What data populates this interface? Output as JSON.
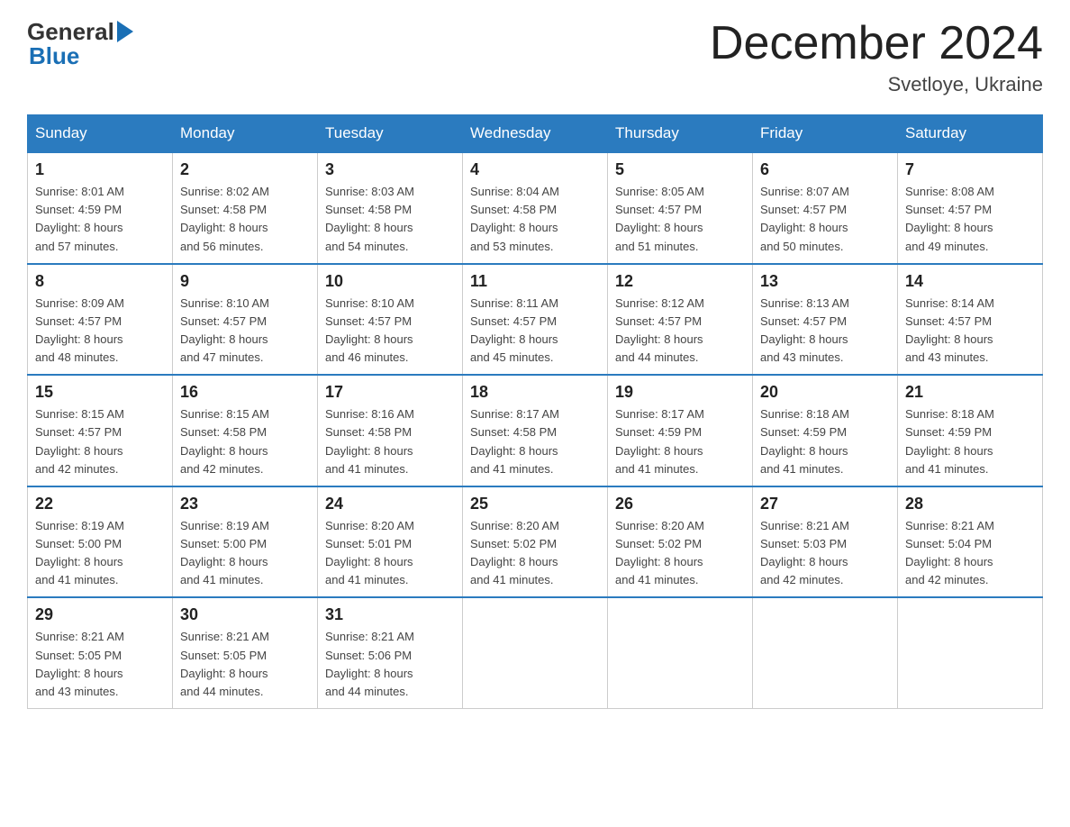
{
  "header": {
    "logo_general": "General",
    "logo_blue": "Blue",
    "month_title": "December 2024",
    "location": "Svetloye, Ukraine"
  },
  "days_of_week": [
    "Sunday",
    "Monday",
    "Tuesday",
    "Wednesday",
    "Thursday",
    "Friday",
    "Saturday"
  ],
  "weeks": [
    [
      {
        "day": "1",
        "sunrise": "8:01 AM",
        "sunset": "4:59 PM",
        "daylight": "8 hours and 57 minutes."
      },
      {
        "day": "2",
        "sunrise": "8:02 AM",
        "sunset": "4:58 PM",
        "daylight": "8 hours and 56 minutes."
      },
      {
        "day": "3",
        "sunrise": "8:03 AM",
        "sunset": "4:58 PM",
        "daylight": "8 hours and 54 minutes."
      },
      {
        "day": "4",
        "sunrise": "8:04 AM",
        "sunset": "4:58 PM",
        "daylight": "8 hours and 53 minutes."
      },
      {
        "day": "5",
        "sunrise": "8:05 AM",
        "sunset": "4:57 PM",
        "daylight": "8 hours and 51 minutes."
      },
      {
        "day": "6",
        "sunrise": "8:07 AM",
        "sunset": "4:57 PM",
        "daylight": "8 hours and 50 minutes."
      },
      {
        "day": "7",
        "sunrise": "8:08 AM",
        "sunset": "4:57 PM",
        "daylight": "8 hours and 49 minutes."
      }
    ],
    [
      {
        "day": "8",
        "sunrise": "8:09 AM",
        "sunset": "4:57 PM",
        "daylight": "8 hours and 48 minutes."
      },
      {
        "day": "9",
        "sunrise": "8:10 AM",
        "sunset": "4:57 PM",
        "daylight": "8 hours and 47 minutes."
      },
      {
        "day": "10",
        "sunrise": "8:10 AM",
        "sunset": "4:57 PM",
        "daylight": "8 hours and 46 minutes."
      },
      {
        "day": "11",
        "sunrise": "8:11 AM",
        "sunset": "4:57 PM",
        "daylight": "8 hours and 45 minutes."
      },
      {
        "day": "12",
        "sunrise": "8:12 AM",
        "sunset": "4:57 PM",
        "daylight": "8 hours and 44 minutes."
      },
      {
        "day": "13",
        "sunrise": "8:13 AM",
        "sunset": "4:57 PM",
        "daylight": "8 hours and 43 minutes."
      },
      {
        "day": "14",
        "sunrise": "8:14 AM",
        "sunset": "4:57 PM",
        "daylight": "8 hours and 43 minutes."
      }
    ],
    [
      {
        "day": "15",
        "sunrise": "8:15 AM",
        "sunset": "4:57 PM",
        "daylight": "8 hours and 42 minutes."
      },
      {
        "day": "16",
        "sunrise": "8:15 AM",
        "sunset": "4:58 PM",
        "daylight": "8 hours and 42 minutes."
      },
      {
        "day": "17",
        "sunrise": "8:16 AM",
        "sunset": "4:58 PM",
        "daylight": "8 hours and 41 minutes."
      },
      {
        "day": "18",
        "sunrise": "8:17 AM",
        "sunset": "4:58 PM",
        "daylight": "8 hours and 41 minutes."
      },
      {
        "day": "19",
        "sunrise": "8:17 AM",
        "sunset": "4:59 PM",
        "daylight": "8 hours and 41 minutes."
      },
      {
        "day": "20",
        "sunrise": "8:18 AM",
        "sunset": "4:59 PM",
        "daylight": "8 hours and 41 minutes."
      },
      {
        "day": "21",
        "sunrise": "8:18 AM",
        "sunset": "4:59 PM",
        "daylight": "8 hours and 41 minutes."
      }
    ],
    [
      {
        "day": "22",
        "sunrise": "8:19 AM",
        "sunset": "5:00 PM",
        "daylight": "8 hours and 41 minutes."
      },
      {
        "day": "23",
        "sunrise": "8:19 AM",
        "sunset": "5:00 PM",
        "daylight": "8 hours and 41 minutes."
      },
      {
        "day": "24",
        "sunrise": "8:20 AM",
        "sunset": "5:01 PM",
        "daylight": "8 hours and 41 minutes."
      },
      {
        "day": "25",
        "sunrise": "8:20 AM",
        "sunset": "5:02 PM",
        "daylight": "8 hours and 41 minutes."
      },
      {
        "day": "26",
        "sunrise": "8:20 AM",
        "sunset": "5:02 PM",
        "daylight": "8 hours and 41 minutes."
      },
      {
        "day": "27",
        "sunrise": "8:21 AM",
        "sunset": "5:03 PM",
        "daylight": "8 hours and 42 minutes."
      },
      {
        "day": "28",
        "sunrise": "8:21 AM",
        "sunset": "5:04 PM",
        "daylight": "8 hours and 42 minutes."
      }
    ],
    [
      {
        "day": "29",
        "sunrise": "8:21 AM",
        "sunset": "5:05 PM",
        "daylight": "8 hours and 43 minutes."
      },
      {
        "day": "30",
        "sunrise": "8:21 AM",
        "sunset": "5:05 PM",
        "daylight": "8 hours and 44 minutes."
      },
      {
        "day": "31",
        "sunrise": "8:21 AM",
        "sunset": "5:06 PM",
        "daylight": "8 hours and 44 minutes."
      },
      null,
      null,
      null,
      null
    ]
  ],
  "labels": {
    "sunrise": "Sunrise:",
    "sunset": "Sunset:",
    "daylight": "Daylight:"
  }
}
